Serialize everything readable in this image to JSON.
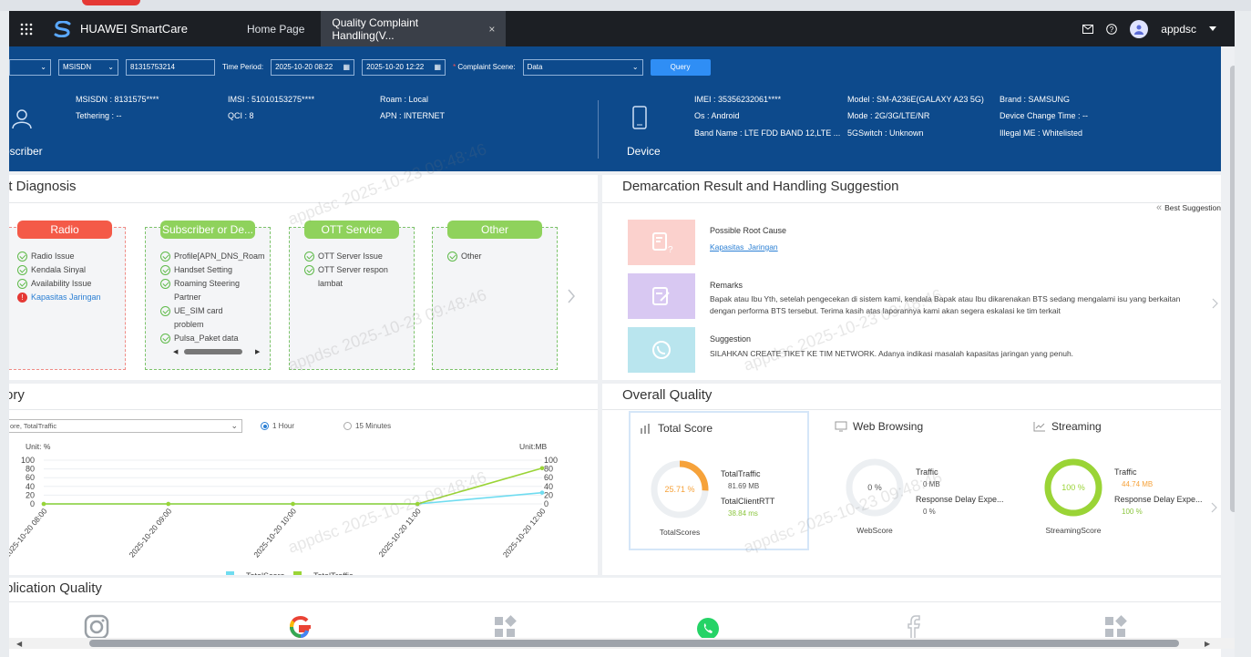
{
  "nav": {
    "brand": "HUAWEI SmartCare",
    "tabs": [
      {
        "label": "Home Page"
      },
      {
        "label": "Quality Complaint Handling(V..."
      }
    ],
    "close": "×",
    "user": "appdsc"
  },
  "filters": {
    "id_type": "MSISDN",
    "msisdn_value": "81315753214",
    "time_period_label": "Time Period:",
    "start_time": "2025-10-20 08:22",
    "end_time": "2025-10-20 12:22",
    "scene_label": "Complaint Scene:",
    "scene_value": "Data",
    "query_label": "Query"
  },
  "subscriber": {
    "label": "bscriber",
    "fields": {
      "msisdn": "MSISDN : 8131575****",
      "tethering": "Tethering : --",
      "imsi": "IMSI : 51010153275****",
      "qci": "QCI : 8",
      "roam": "Roam : Local",
      "apn": "APN : INTERNET"
    }
  },
  "device": {
    "label": "Device",
    "fields": {
      "imei": "IMEI : 35356232061****",
      "os": "Os : Android",
      "band": "Band Name : LTE FDD BAND 12,LTE ...",
      "model": "Model : SM-A236E(GALAXY A23 5G)",
      "mode": "Mode : 2G/3G/LTE/NR",
      "switch5g": "5GSwitch : Unknown",
      "brand": "Brand : SAMSUNG",
      "change_time": "Device Change Time : --",
      "illegal": "Illegal ME : Whitelisted"
    }
  },
  "diagnosis": {
    "title": "lt Diagnosis",
    "cards": [
      {
        "title": "Radio",
        "items": [
          "Radio Issue",
          "Kendala Sinyal",
          "Availability Issue",
          "Kapasitas Jaringan"
        ]
      },
      {
        "title": "Subscriber or De...",
        "items": [
          "Profile[APN_DNS_Roam",
          "Handset Setting",
          "Roaming Steering Partner",
          "UE_SIM card problem",
          "Pulsa_Paket data"
        ]
      },
      {
        "title": "OTT Service",
        "items": [
          "OTT Server Issue",
          "OTT Server respon lambat"
        ]
      },
      {
        "title": "Other",
        "items": [
          "Other"
        ]
      }
    ]
  },
  "demarcation": {
    "title": "Demarcation Result and Handling Suggestion",
    "best": "Best Suggestion",
    "root_cause_label": "Possible Root Cause",
    "root_cause_value": "Kapasitas_Jaringan",
    "remarks_label": "Remarks",
    "remarks_value": "Bapak atau Ibu Yth, setelah pengecekan di sistem kami, kendala Bapak atau Ibu dikarenakan BTS sedang mengalami isu yang berkaitan dengan performa BTS tersebut. Terima kasih atas laporannya kami akan segera eskalasi ke tim terkait",
    "suggestion_label": "Suggestion",
    "suggestion_value": "SILAHKAN CREATE TIKET KE TIM NETWORK. Adanya indikasi masalah kapasitas jaringan yang penuh."
  },
  "history": {
    "title": "ory",
    "metric_select": "ore, TotalTraffic",
    "granularity": [
      {
        "label": "1 Hour",
        "selected": true
      },
      {
        "label": "15 Minutes",
        "selected": false
      }
    ],
    "unit_left": "Unit: %",
    "unit_right": "Unit:MB"
  },
  "chart_data": {
    "type": "line",
    "x": [
      "2025-10-20 08:00",
      "2025-10-20 09:00",
      "2025-10-20 10:00",
      "2025-10-20 11:00",
      "2025-10-20 12:00"
    ],
    "series": [
      {
        "name": "TotalScore",
        "values": [
          0,
          0,
          0,
          0,
          25.71
        ],
        "color": "#6fdcf0",
        "axis": "left"
      },
      {
        "name": "TotalTraffic",
        "values": [
          0,
          0,
          0,
          0,
          81.69
        ],
        "color": "#9ad436",
        "axis": "right"
      }
    ],
    "ylabel_left": "Unit: %",
    "ylabel_right": "Unit:MB",
    "ylim": [
      0,
      100
    ],
    "yticks": [
      0,
      20,
      40,
      60,
      80,
      100
    ],
    "grid": true,
    "legend": "bottom"
  },
  "overall": {
    "title": "Overall Quality",
    "total": {
      "title": "Total Score",
      "score": "25.71 %",
      "score_value": 25.71,
      "k1": "TotalTraffic",
      "v1": "81.69 MB",
      "k2": "TotalClientRTT",
      "v2": "38.84 ms",
      "caption": "TotalScores"
    },
    "web": {
      "title": "Web Browsing",
      "score": "0 %",
      "score_value": 0,
      "k1": "Traffic",
      "v1": "0 MB",
      "k2": "Response Delay Expe...",
      "v2": "0 %",
      "caption": "WebScore"
    },
    "streaming": {
      "title": "Streaming",
      "score": "100 %",
      "score_value": 100,
      "k1": "Traffic",
      "v1": "44.74 MB",
      "k2": "Response Delay Expe...",
      "v2": "100 %",
      "caption": "StreamingScore"
    }
  },
  "app_quality": {
    "title": "plication Quality"
  },
  "watermark": "appdsc 2025-10-23 09:48:46",
  "colors": {
    "navy": "#0d4a8c",
    "green": "#8fd25c",
    "red": "#f45a48",
    "orange": "#f6a23a",
    "stream": "#9ad436"
  }
}
